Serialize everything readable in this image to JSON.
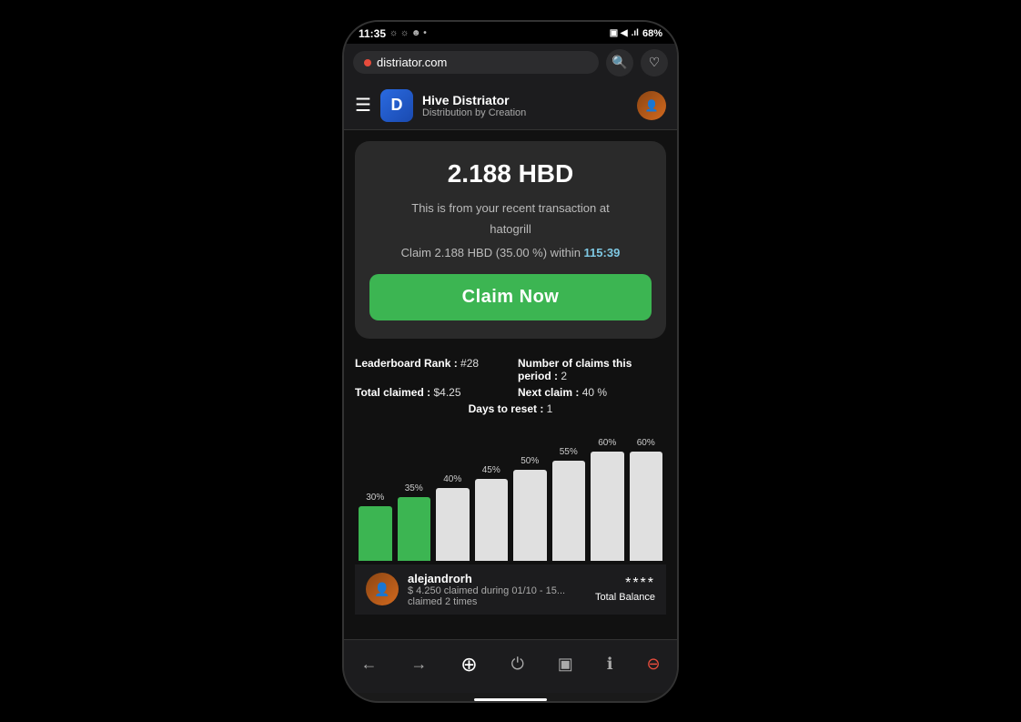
{
  "status_bar": {
    "time": "11:35",
    "battery": "68%",
    "signal_icons": "▣ ◀ ᵀᶠ .ıl"
  },
  "browser": {
    "url": "distriator.com",
    "search_icon": "🔍",
    "bookmark_icon": "♡"
  },
  "site_header": {
    "logo_letter": "D",
    "title": "Hive Distriator",
    "subtitle": "Distribution by Creation"
  },
  "claim_card": {
    "amount": "2.188 HBD",
    "description_line1": "This is from your recent transaction at",
    "description_line2": "hatogrill",
    "claim_text_prefix": "Claim 2.188 HBD (35.00 %) within",
    "timer": "115:39",
    "button_label": "Claim Now"
  },
  "stats": {
    "leaderboard_label": "Leaderboard Rank :",
    "leaderboard_value": "#28",
    "claims_label": "Number of claims this period :",
    "claims_value": "2",
    "total_claimed_label": "Total claimed :",
    "total_claimed_value": "$4.25",
    "next_claim_label": "Next claim :",
    "next_claim_value": "40 %",
    "days_reset_label": "Days to reset :",
    "days_reset_value": "1"
  },
  "chart": {
    "bars": [
      {
        "label": "30%",
        "height_pct": 30,
        "color": "green"
      },
      {
        "label": "35%",
        "height_pct": 35,
        "color": "green"
      },
      {
        "label": "40%",
        "height_pct": 40,
        "color": "white"
      },
      {
        "label": "45%",
        "height_pct": 45,
        "color": "white"
      },
      {
        "label": "50%",
        "height_pct": 50,
        "color": "white"
      },
      {
        "label": "55%",
        "height_pct": 55,
        "color": "white"
      },
      {
        "label": "60%",
        "height_pct": 60,
        "color": "white"
      },
      {
        "label": "60%",
        "height_pct": 60,
        "color": "white"
      }
    ]
  },
  "profile": {
    "name": "alejandrorh",
    "detail_line1": "$ 4.250 claimed during 01/10 - 15...",
    "detail_line2": "claimed 2 times",
    "balance_stars": "****",
    "balance_label": "Total Balance"
  },
  "nav": {
    "back": "←",
    "forward": "→",
    "refresh": "↺",
    "home": "⏻",
    "tabs": "▣",
    "info": "ℹ",
    "close": "✕"
  },
  "colors": {
    "green": "#3cb552",
    "timer_color": "#7ec8e3",
    "card_bg": "#2a2a2a",
    "page_bg": "#111"
  }
}
